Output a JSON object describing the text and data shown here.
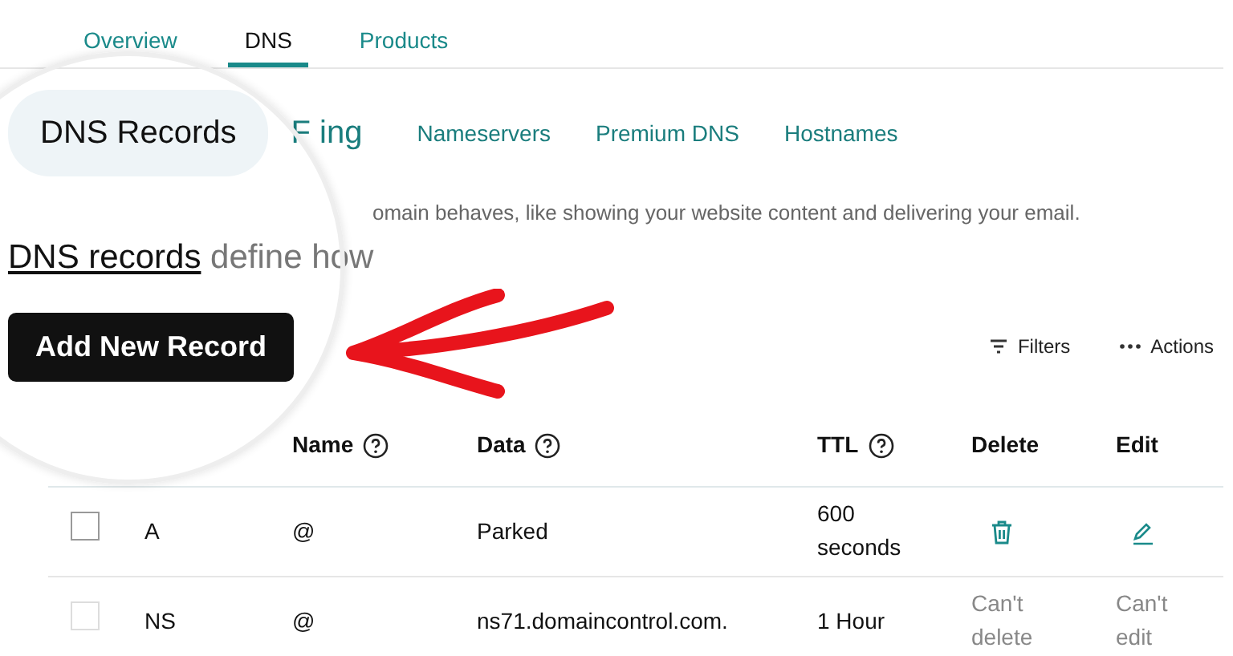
{
  "top_tabs": [
    {
      "label": "Overview",
      "selected": false
    },
    {
      "label": "DNS",
      "selected": true
    },
    {
      "label": "Products",
      "selected": false
    }
  ],
  "sub_tabs": [
    {
      "label": "DNS Records",
      "selected": true,
      "magnified": true
    },
    {
      "label": "F ing",
      "selected": false,
      "magnified": true
    },
    {
      "label": "Nameservers",
      "selected": false,
      "magnified": false
    },
    {
      "label": "Premium DNS",
      "selected": false,
      "magnified": false
    },
    {
      "label": "Hostnames",
      "selected": false,
      "magnified": false
    }
  ],
  "description": {
    "outside_text": "omain behaves, like showing your website content and delivering your email.",
    "lens_link": "DNS records",
    "lens_text": "define how"
  },
  "add_button": "Add New Record",
  "toolbar": [
    {
      "kind": "filter",
      "label": "Filters"
    },
    {
      "kind": "more",
      "label": "Actions"
    }
  ],
  "table": {
    "columns": [
      {
        "label": "Name",
        "help": true
      },
      {
        "label": "Data",
        "help": true
      },
      {
        "label": "TTL",
        "help": true
      },
      {
        "label": "Delete",
        "help": false
      },
      {
        "label": "Edit",
        "help": false
      }
    ],
    "rows": [
      {
        "disabled": false,
        "type": "A",
        "name": "@",
        "data": "Parked",
        "ttl": "600 seconds"
      },
      {
        "disabled": true,
        "type": "NS",
        "name": "@",
        "data": "ns71.domaincontrol.com.",
        "ttl": "1 Hour",
        "delete": "Can't delete",
        "edit": "Can't edit"
      }
    ]
  }
}
